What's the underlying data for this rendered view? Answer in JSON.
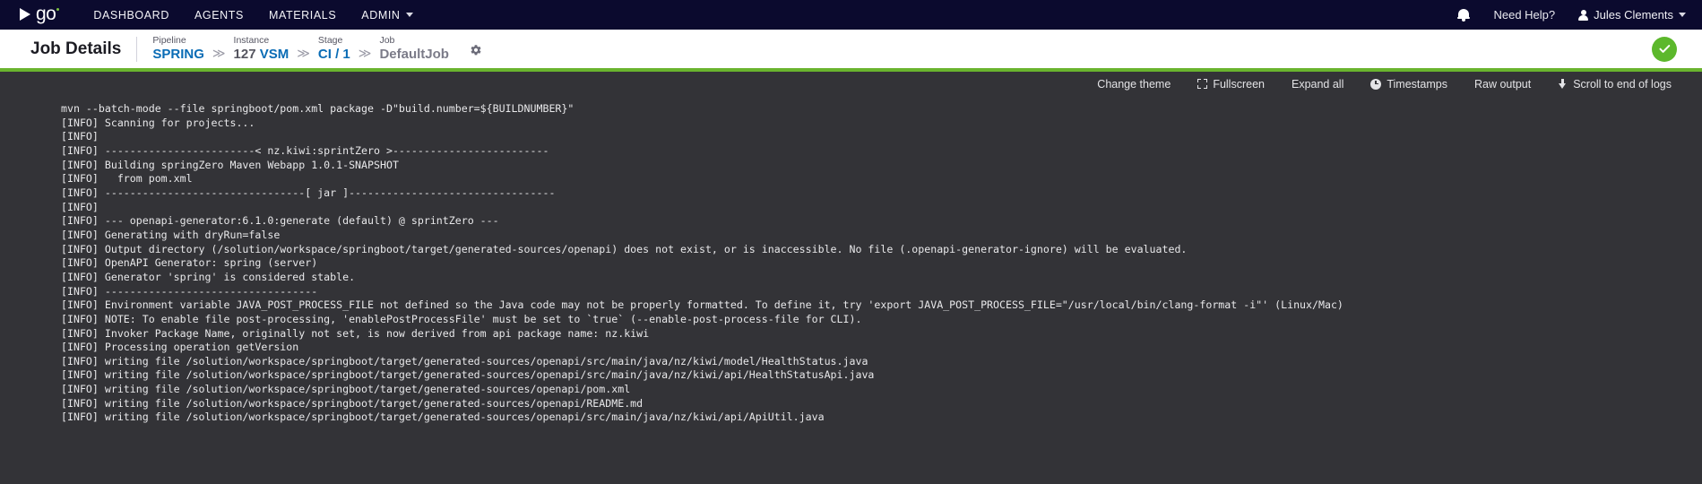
{
  "topnav": {
    "brand": "go",
    "links": [
      {
        "label": "DASHBOARD",
        "has_caret": false
      },
      {
        "label": "AGENTS",
        "has_caret": false
      },
      {
        "label": "MATERIALS",
        "has_caret": false
      },
      {
        "label": "ADMIN",
        "has_caret": true
      }
    ],
    "need_help": "Need Help?",
    "user_name": "Jules Clements",
    "icons": {
      "bell": "bell-icon",
      "user": "user-icon",
      "caret": "caret-down-icon"
    },
    "background": "#0b0a2e"
  },
  "pagehead": {
    "title": "Job Details",
    "breadcrumbs": [
      {
        "label": "Pipeline",
        "value": "SPRING",
        "link": true
      },
      {
        "label": "Instance",
        "value_prefix": "127 ",
        "value": "VSM",
        "link": true
      },
      {
        "label": "Stage",
        "value": "CI / 1",
        "link": true
      },
      {
        "label": "Job",
        "value": "DefaultJob",
        "link": false
      }
    ],
    "separator": "≫",
    "gear_icon": "gear-icon",
    "status": {
      "icon": "check-icon",
      "color": "#5cb82c",
      "state": "passed"
    },
    "rule_color": "#6ab42e"
  },
  "log_toolbar": {
    "items": [
      {
        "label": "Change theme",
        "icon": null
      },
      {
        "label": "Fullscreen",
        "icon": "fullscreen-icon"
      },
      {
        "label": "Expand all",
        "icon": null
      },
      {
        "label": "Timestamps",
        "icon": "clock-icon"
      },
      {
        "label": "Raw output",
        "icon": null
      },
      {
        "label": "Scroll to end of logs",
        "icon": "arrow-down-icon"
      }
    ],
    "background": "#333337"
  },
  "console": {
    "background": "#333337",
    "text_color": "#e8e8ea",
    "lines": [
      "mvn --batch-mode --file springboot/pom.xml package -D\"build.number=${BUILDNUMBER}\"",
      "[INFO] Scanning for projects...",
      "[INFO]",
      "[INFO] ------------------------< nz.kiwi:sprintZero >-------------------------",
      "[INFO] Building springZero Maven Webapp 1.0.1-SNAPSHOT",
      "[INFO]   from pom.xml",
      "[INFO] --------------------------------[ jar ]---------------------------------",
      "[INFO]",
      "[INFO] --- openapi-generator:6.1.0:generate (default) @ sprintZero ---",
      "[INFO] Generating with dryRun=false",
      "[INFO] Output directory (/solution/workspace/springboot/target/generated-sources/openapi) does not exist, or is inaccessible. No file (.openapi-generator-ignore) will be evaluated.",
      "[INFO] OpenAPI Generator: spring (server)",
      "[INFO] Generator 'spring' is considered stable.",
      "[INFO] ----------------------------------",
      "[INFO] Environment variable JAVA_POST_PROCESS_FILE not defined so the Java code may not be properly formatted. To define it, try 'export JAVA_POST_PROCESS_FILE=\"/usr/local/bin/clang-format -i\"' (Linux/Mac)",
      "[INFO] NOTE: To enable file post-processing, 'enablePostProcessFile' must be set to `true` (--enable-post-process-file for CLI).",
      "[INFO] Invoker Package Name, originally not set, is now derived from api package name: nz.kiwi",
      "[INFO] Processing operation getVersion",
      "[INFO] writing file /solution/workspace/springboot/target/generated-sources/openapi/src/main/java/nz/kiwi/model/HealthStatus.java",
      "[INFO] writing file /solution/workspace/springboot/target/generated-sources/openapi/src/main/java/nz/kiwi/api/HealthStatusApi.java",
      "[INFO] writing file /solution/workspace/springboot/target/generated-sources/openapi/pom.xml",
      "[INFO] writing file /solution/workspace/springboot/target/generated-sources/openapi/README.md",
      "[INFO] writing file /solution/workspace/springboot/target/generated-sources/openapi/src/main/java/nz/kiwi/api/ApiUtil.java"
    ]
  }
}
